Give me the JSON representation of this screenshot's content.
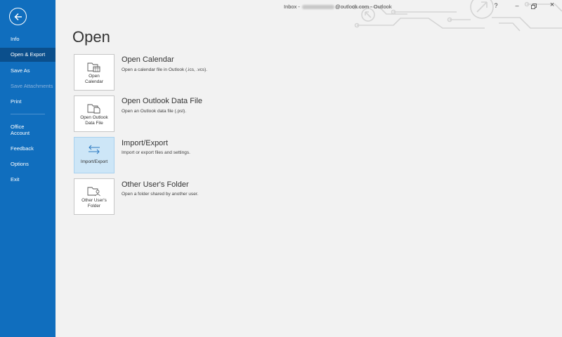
{
  "window": {
    "title_prefix": "Inbox - ",
    "title_suffix": "@outlook.com  -  Outlook",
    "help_icon": "?",
    "minimize_icon": "–",
    "restore_icon": "restore",
    "close_icon": "×"
  },
  "sidebar": {
    "back_icon": "back-arrow-icon",
    "items": [
      {
        "label": "Info"
      },
      {
        "label": "Open & Export",
        "selected": true
      },
      {
        "label": "Save As"
      },
      {
        "label": "Save Attachments",
        "disabled": true
      },
      {
        "label": "Print"
      },
      {
        "label": "Office\nAccount"
      },
      {
        "label": "Feedback"
      },
      {
        "label": "Options"
      },
      {
        "label": "Exit"
      }
    ],
    "colors": {
      "background": "#106ebe",
      "selected": "#0b4f8c"
    }
  },
  "main": {
    "title": "Open",
    "options": [
      {
        "tile_label": "Open\nCalendar",
        "title": "Open Calendar",
        "description": "Open a calendar file in Outlook (.ics, .vcs).",
        "icon": "folder-calendar-icon"
      },
      {
        "tile_label": "Open Outlook\nData File",
        "title": "Open Outlook Data File",
        "description": "Open an Outlook data file (.pst).",
        "icon": "folder-datafile-icon"
      },
      {
        "tile_label": "Import/Export",
        "title": "Import/Export",
        "description": "Import or export files and settings.",
        "icon": "import-export-arrows-icon",
        "active": true
      },
      {
        "tile_label": "Other User's\nFolder",
        "title": "Other User's Folder",
        "description": "Open a folder shared by another user.",
        "icon": "shared-folder-icon"
      }
    ]
  }
}
